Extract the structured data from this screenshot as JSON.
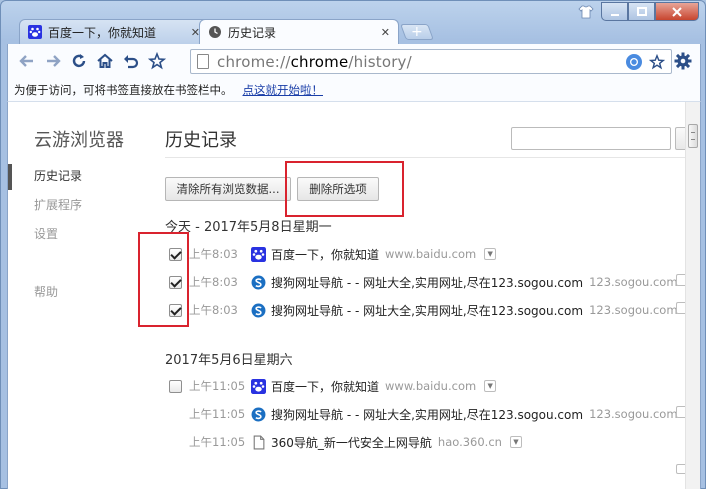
{
  "tabs": [
    {
      "label": "百度一下，你就知道",
      "active": false,
      "icon": "baidu-paw-icon"
    },
    {
      "label": "历史记录",
      "active": true,
      "icon": "clock-icon"
    }
  ],
  "toolbar": {
    "url_scheme": "chrome://",
    "url_host": "chrome",
    "url_path": "/history/"
  },
  "bookmark_bar": {
    "text": "为便于访问，可将书签直接放在书签栏中。",
    "link": "点这就开始啦！"
  },
  "sidebar": {
    "brand": "云游浏览器",
    "items": [
      {
        "label": "历史记录",
        "active": true
      },
      {
        "label": "扩展程序",
        "active": false
      },
      {
        "label": "设置",
        "active": false
      }
    ],
    "help": "帮助"
  },
  "main": {
    "title": "历史记录",
    "search_value": "",
    "clear_all_label": "清除所有浏览数据...",
    "delete_selected_label": "删除所选项",
    "days": [
      {
        "header": "今天 - 2017年5月8日星期一",
        "entries": [
          {
            "time": "上午8:03",
            "title": "百度一下，你就知道",
            "domain": "www.baidu.com",
            "checked": true,
            "icon": "baidu-paw-icon"
          },
          {
            "time": "上午8:03",
            "title": "搜狗网址导航 - - 网址大全,实用网址,尽在123.sogou.com",
            "domain": "123.sogou.com",
            "checked": true,
            "icon": "sogou-icon"
          },
          {
            "time": "上午8:03",
            "title": "搜狗网址导航 - - 网址大全,实用网址,尽在123.sogou.com",
            "domain": "123.sogou.com",
            "checked": true,
            "icon": "sogou-icon"
          }
        ]
      },
      {
        "header": "2017年5月6日星期六",
        "entries": [
          {
            "time": "上午11:05",
            "title": "百度一下，你就知道",
            "domain": "www.baidu.com",
            "checked": false,
            "icon": "baidu-paw-icon"
          },
          {
            "time": "上午11:05",
            "title": "搜狗网址导航 - - 网址大全,实用网址,尽在123.sogou.com",
            "domain": "123.sogou.com",
            "checked": false,
            "icon": "sogou-icon"
          },
          {
            "time": "上午11:05",
            "title": "360导航_新一代安全上网导航",
            "domain": "hao.360.cn",
            "checked": false,
            "icon": "page-icon"
          }
        ]
      }
    ]
  },
  "colors": {
    "frame": "#a9c2e0",
    "highlight": "#d9232e",
    "link": "#1a3ea8",
    "baidu": "#2932e1",
    "sogou": "#1b6fc2"
  }
}
